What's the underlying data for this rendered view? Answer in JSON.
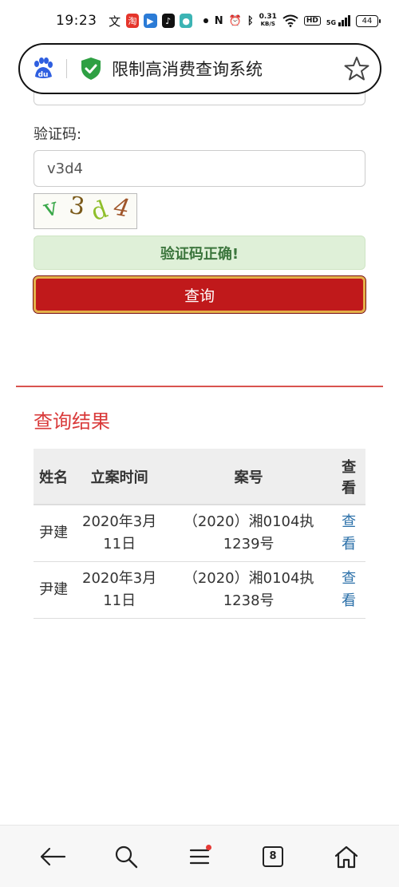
{
  "status_bar": {
    "time": "19:23",
    "net_speed_value": "0.31",
    "net_speed_unit": "KB/S",
    "hd_label": "HD",
    "battery": "44",
    "signal_label": "5G"
  },
  "address_bar": {
    "site_title": "限制高消费查询系统"
  },
  "form": {
    "captcha_label": "验证码:",
    "captcha_value": "v3d4",
    "captcha_chars": [
      "v",
      "3",
      "d",
      "4"
    ],
    "success_message": "验证码正确!",
    "query_button_label": "查询"
  },
  "results": {
    "title": "查询结果",
    "headers": [
      "姓名",
      "立案时间",
      "案号",
      "查看"
    ],
    "rows": [
      {
        "name": "尹建",
        "date": "2020年3月11日",
        "case_no": "（2020）湘0104执1239号",
        "view": "查看"
      },
      {
        "name": "尹建",
        "date": "2020年3月11日",
        "case_no": "（2020）湘0104执1238号",
        "view": "查看"
      }
    ]
  },
  "bottom_nav": {
    "tab_count": "8"
  },
  "colors": {
    "accent_red": "#c0191b",
    "success_bg": "#dff0d8",
    "success_text": "#3c763d",
    "link_blue": "#2a6fa8"
  }
}
